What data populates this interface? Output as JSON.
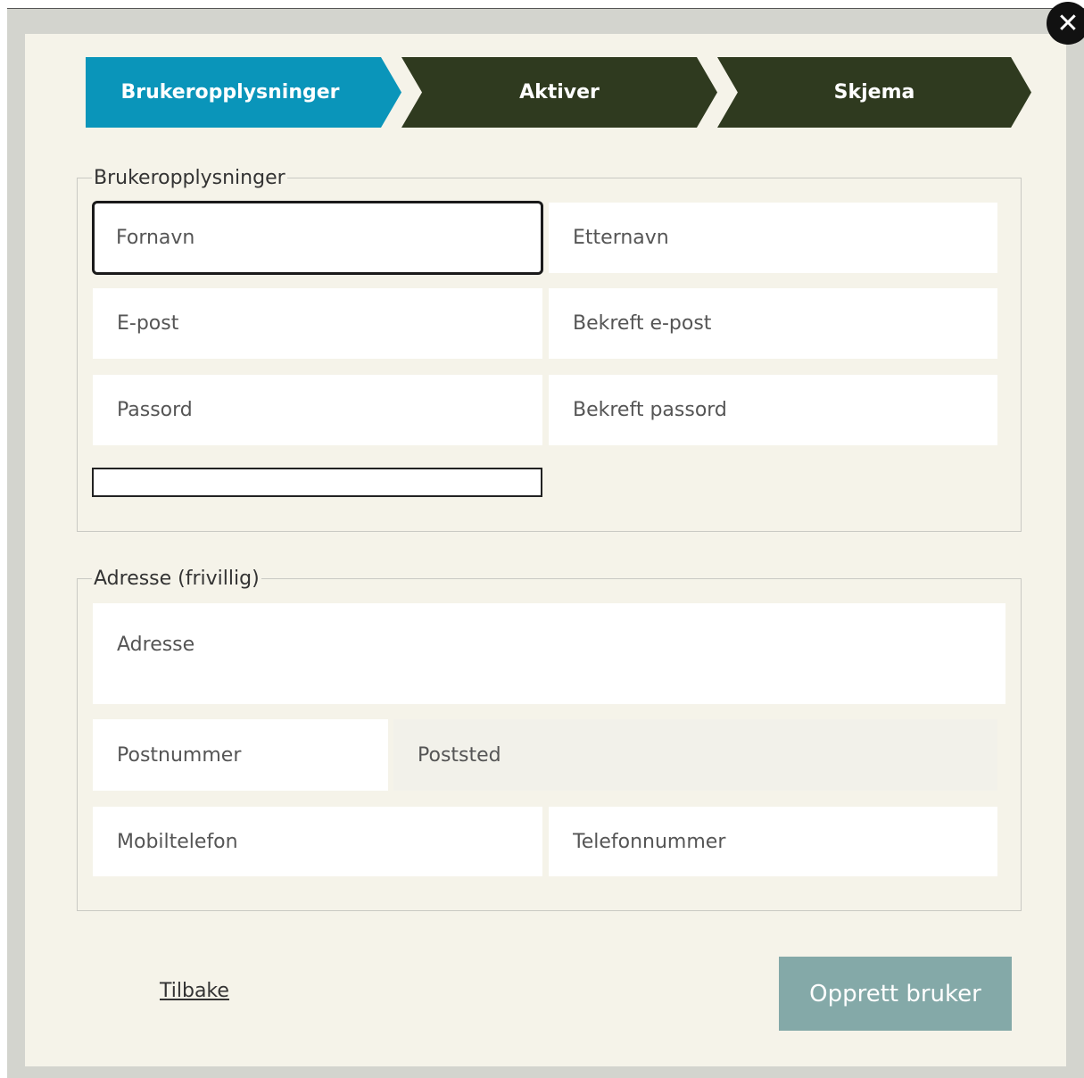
{
  "steps": [
    {
      "label": "Brukeropplysninger",
      "state": "active"
    },
    {
      "label": "Aktiver",
      "state": "inactive"
    },
    {
      "label": "Skjema",
      "state": "inactive"
    }
  ],
  "user_info": {
    "legend": "Brukeropplysninger",
    "first_name": {
      "placeholder": "Fornavn",
      "value": ""
    },
    "last_name": {
      "placeholder": "Etternavn",
      "value": ""
    },
    "email": {
      "placeholder": "E-post",
      "value": ""
    },
    "confirm_email": {
      "placeholder": "Bekreft e-post",
      "value": ""
    },
    "password": {
      "placeholder": "Passord",
      "value": ""
    },
    "confirm_password": {
      "placeholder": "Bekreft passord",
      "value": ""
    }
  },
  "address": {
    "legend": "Adresse (frivillig)",
    "street": {
      "placeholder": "Adresse",
      "value": ""
    },
    "postal_code": {
      "placeholder": "Postnummer",
      "value": ""
    },
    "city": {
      "placeholder": "Poststed",
      "value": ""
    },
    "mobile": {
      "placeholder": "Mobiltelefon",
      "value": ""
    },
    "phone": {
      "placeholder": "Telefonnummer",
      "value": ""
    }
  },
  "footer": {
    "back_label": "Tilbake",
    "submit_label": "Opprett bruker"
  },
  "colors": {
    "active_step": "#0a95ba",
    "inactive_step": "#2f3a1f",
    "submit_button": "#84a9a8",
    "modal_background": "#f5f3e9"
  },
  "icons": {
    "close": "close-icon"
  }
}
